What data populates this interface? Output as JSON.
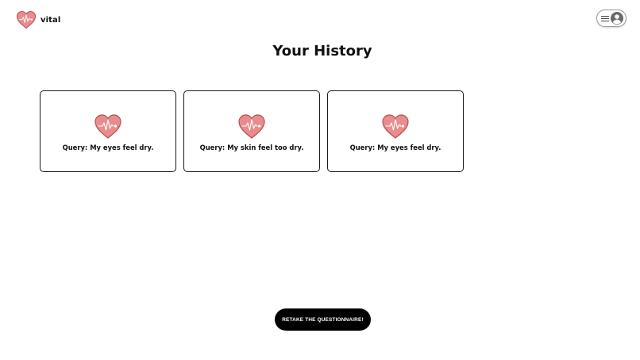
{
  "brand": {
    "name": "vital",
    "logo_icon": "heart-pulse-icon"
  },
  "header": {
    "menu_icon": "hamburger-icon",
    "profile_icon": "user-circle-icon"
  },
  "main": {
    "title": "Your History",
    "history": [
      {
        "query": "Query: My eyes feel dry.",
        "icon": "heart-pulse-icon"
      },
      {
        "query": "Query: My skin feel too dry.",
        "icon": "heart-pulse-icon"
      },
      {
        "query": "Query: My eyes feel dry.",
        "icon": "heart-pulse-icon"
      }
    ]
  },
  "cta": {
    "label": "RETAKE THE QUESTIONNAIRE!"
  },
  "colors": {
    "heart_fill": "#e78d8d",
    "heart_stroke": "#b54f4f",
    "pulse_line": "#ffffff",
    "button_bg": "#000000",
    "button_text": "#ffffff"
  }
}
